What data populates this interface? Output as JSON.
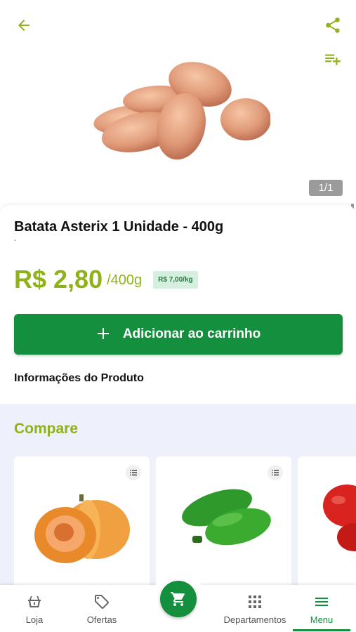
{
  "header": {
    "back_icon": "arrow-back-icon",
    "share_icon": "share-icon",
    "add_to_list_icon": "playlist-add-icon",
    "image_counter": "1/1"
  },
  "product": {
    "title": "Batata Asterix 1 Unidade - 400g",
    "subtitle": "-",
    "price": "R$ 2,80",
    "price_unit": "/400g",
    "price_per_kg": "R$ 7,00/kg",
    "add_to_cart_label": "Adicionar ao carrinho",
    "info_section_title": "Informações do Produto"
  },
  "compare": {
    "title": "Compare",
    "cards": [
      {
        "product": "pumpkin"
      },
      {
        "product": "green-pepper"
      },
      {
        "product": "red-pepper"
      }
    ]
  },
  "bottom_nav": {
    "items": [
      {
        "label": "Loja",
        "icon": "basket-icon"
      },
      {
        "label": "Ofertas",
        "icon": "tag-icon"
      },
      {
        "label": "Departamentos",
        "icon": "grid-icon"
      },
      {
        "label": "Menu",
        "icon": "menu-icon"
      }
    ],
    "active": "Menu",
    "cart_icon": "cart-icon"
  },
  "colors": {
    "primary_green": "#138f3d",
    "lime": "#8fb21a",
    "compare_bg": "#eef0fb"
  }
}
